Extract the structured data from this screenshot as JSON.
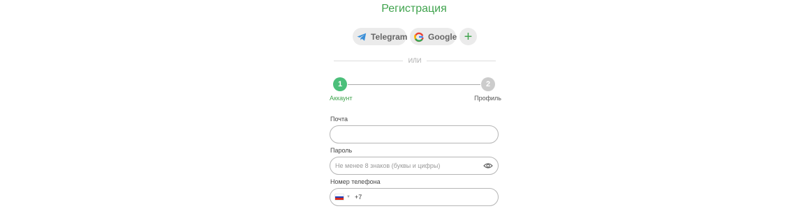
{
  "page": {
    "title": "Регистрация"
  },
  "social": {
    "telegram_label": "Telegram",
    "google_label": "Google",
    "more_label": "+"
  },
  "divider": {
    "text": "ИЛИ"
  },
  "steps": [
    {
      "number": "1",
      "label": "Аккаунт",
      "active": true
    },
    {
      "number": "2",
      "label": "Профиль",
      "active": false
    }
  ],
  "form": {
    "email": {
      "label": "Почта",
      "value": ""
    },
    "password": {
      "label": "Пароль",
      "placeholder": "Не менее 8 знаков (буквы и цифры)"
    },
    "phone": {
      "label": "Номер телефона",
      "prefix": "+7",
      "country_flag": "ru-flag"
    }
  },
  "colors": {
    "accent": "#3fa34d",
    "step_active": "#4bbf7a",
    "step_inactive": "#cccccc",
    "button_bg": "#ebebeb"
  }
}
